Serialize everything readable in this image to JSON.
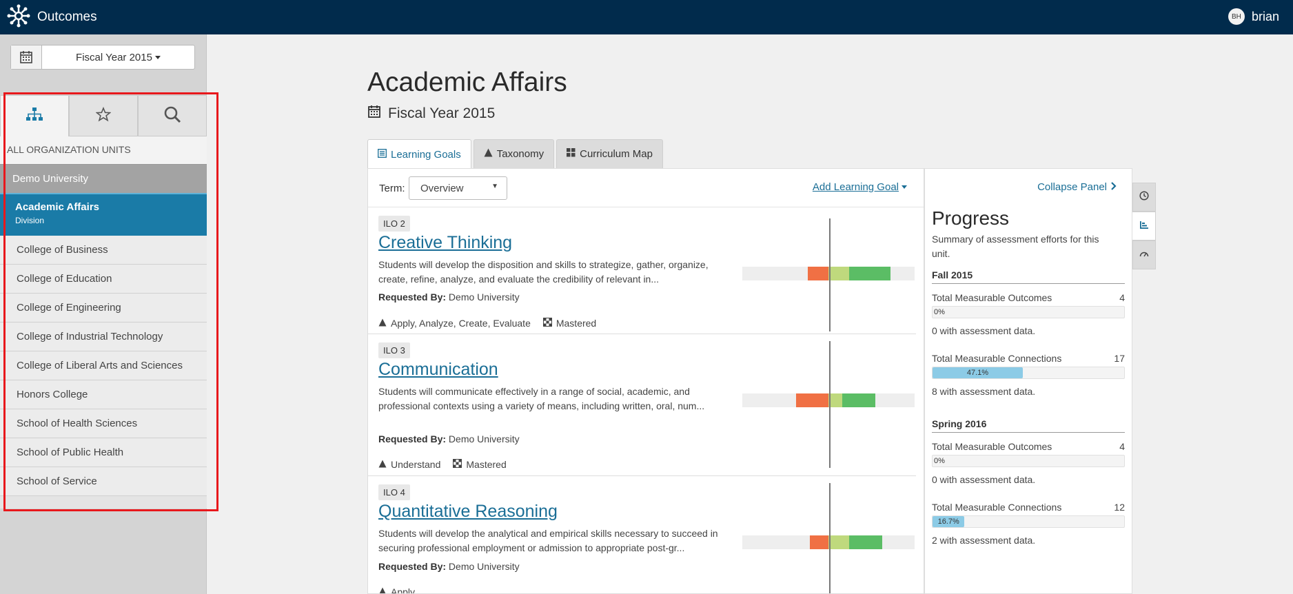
{
  "app": {
    "title": "Outcomes"
  },
  "user": {
    "initials": "BH",
    "name": "brian"
  },
  "sidebar": {
    "fiscal_year": "Fiscal Year 2015",
    "section_label": "ALL ORGANIZATION UNITS",
    "root_unit": "Demo University",
    "active_unit": {
      "name": "Academic Affairs",
      "type": "Division"
    },
    "units": [
      "College of Business",
      "College of Education",
      "College of Engineering",
      "College of Industrial Technology",
      "College of Liberal Arts and Sciences",
      "Honors College",
      "School of Health Sciences",
      "School of Public Health",
      "School of Service"
    ]
  },
  "header": {
    "title": "Academic Affairs",
    "subtitle": "Fiscal Year 2015"
  },
  "tabs": [
    {
      "label": "Learning Goals",
      "active": true
    },
    {
      "label": "Taxonomy",
      "active": false
    },
    {
      "label": "Curriculum Map",
      "active": false
    }
  ],
  "toolbar": {
    "term_label": "Term:",
    "term_value": "Overview",
    "add_goal": "Add Learning Goal"
  },
  "goals": [
    {
      "badge": "ILO 2",
      "title": "Creative Thinking",
      "description": "Students will develop the disposition and skills to strategize, gather, organize, create, refine, analyze, and evaluate the credibility of relevant in...",
      "requested_label": "Requested By:",
      "requested_by": "Demo University",
      "taxonomy": "Apply, Analyze, Create, Evaluate",
      "mastery": "Mastered",
      "distribution": {
        "red": 0.12,
        "yellow": 0.12,
        "green": 0.24
      }
    },
    {
      "badge": "ILO 3",
      "title": "Communication",
      "description": "Students will communicate effectively in a range of social, academic, and professional contexts using a variety of means, including written, oral, num...",
      "requested_label": "Requested By:",
      "requested_by": "Demo University",
      "taxonomy": "Understand",
      "mastery": "Mastered",
      "distribution": {
        "red": 0.19,
        "yellow": 0.08,
        "green": 0.19
      }
    },
    {
      "badge": "ILO 4",
      "title": "Quantitative Reasoning",
      "description": "Students will develop the analytical and empirical skills necessary to succeed in securing professional employment or admission to appropriate post-gr...",
      "requested_label": "Requested By:",
      "requested_by": "Demo University",
      "taxonomy": "Apply",
      "mastery": "",
      "distribution": {
        "red": 0.11,
        "yellow": 0.12,
        "green": 0.19
      }
    }
  ],
  "progress": {
    "collapse_label": "Collapse Panel",
    "title": "Progress",
    "subtitle": "Summary of assessment efforts for this unit.",
    "terms": [
      {
        "name": "Fall 2015",
        "outcomes_label": "Total Measurable Outcomes",
        "outcomes_count": "4",
        "outcomes_pct_label": "0%",
        "outcomes_pct": 0,
        "outcomes_note": "0 with assessment data.",
        "connections_label": "Total Measurable Connections",
        "connections_count": "17",
        "connections_pct_label": "47.1%",
        "connections_pct": 47.1,
        "connections_note": "8 with assessment data."
      },
      {
        "name": "Spring 2016",
        "outcomes_label": "Total Measurable Outcomes",
        "outcomes_count": "4",
        "outcomes_pct_label": "0%",
        "outcomes_pct": 0,
        "outcomes_note": "0 with assessment data.",
        "connections_label": "Total Measurable Connections",
        "connections_count": "12",
        "connections_pct_label": "16.7%",
        "connections_pct": 16.7,
        "connections_note": "2 with assessment data."
      }
    ]
  },
  "colors": {
    "topbar": "#012b4c",
    "accent": "#1a7ba7",
    "link": "#1a6e96",
    "highlight": "#e8181c",
    "bad": "#f07044",
    "ok": "#bfd97d",
    "good": "#5bbd65",
    "progress": "#8ccbe6"
  }
}
